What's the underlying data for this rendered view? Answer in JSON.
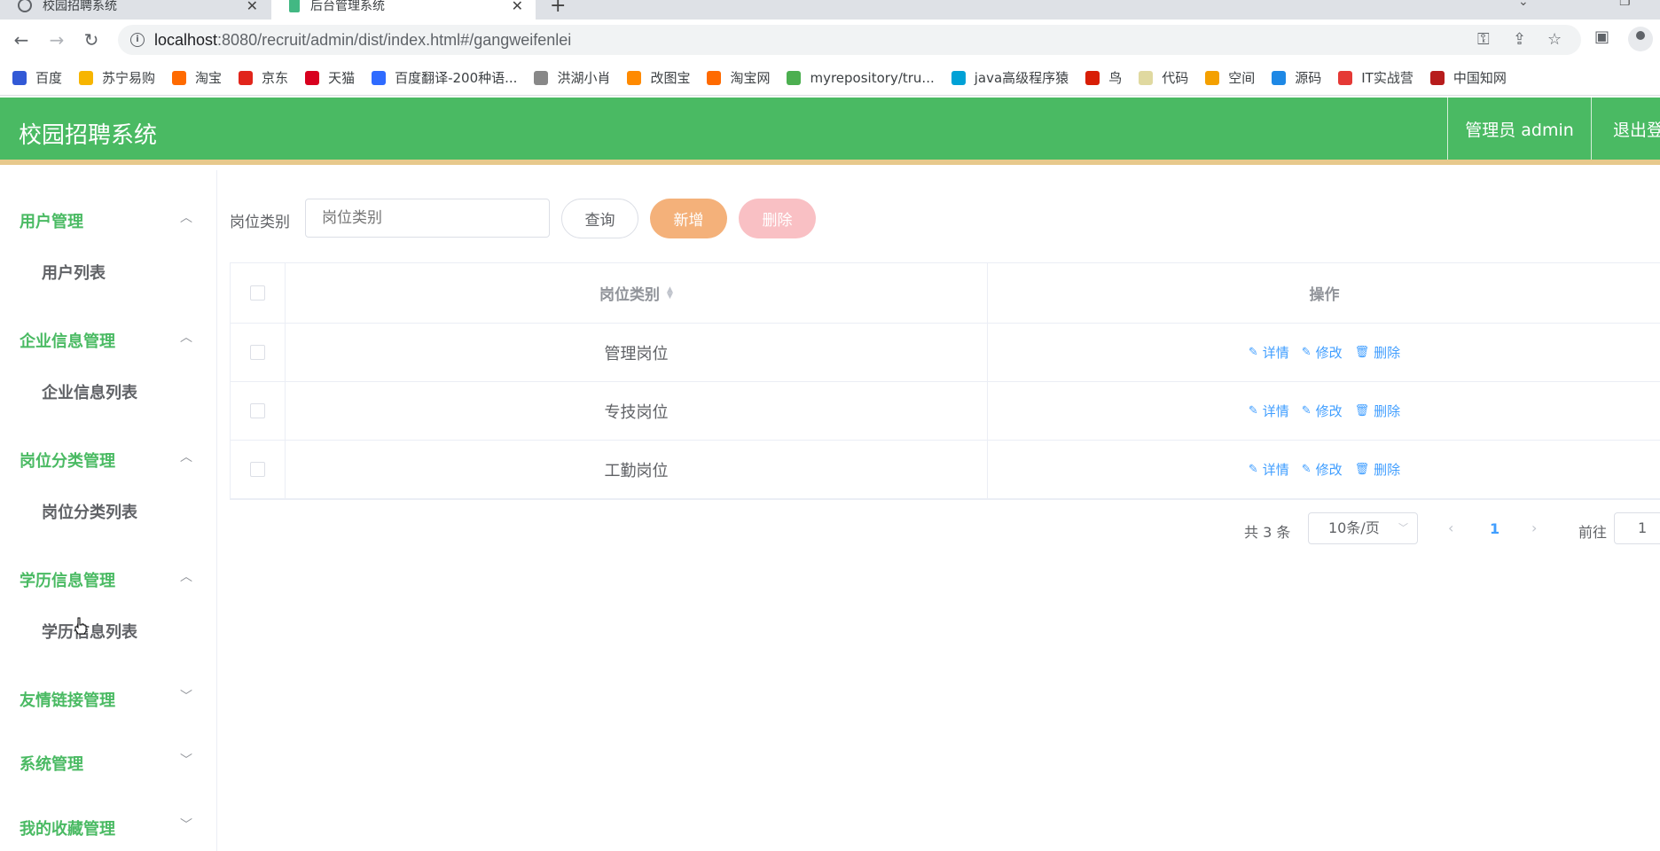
{
  "browser": {
    "tabs": [
      {
        "title": "校园招聘系统"
      },
      {
        "title": "后台管理系统"
      }
    ],
    "url_host": "localhost",
    "url_path": ":8080/recruit/admin/dist/index.html#/gangweifenlei",
    "bookmarks": [
      {
        "label": "百度",
        "color": "#3259d6"
      },
      {
        "label": "苏宁易购",
        "color": "#f7b500"
      },
      {
        "label": "淘宝",
        "color": "#ff6a00"
      },
      {
        "label": "京东",
        "color": "#e1251b"
      },
      {
        "label": "天猫",
        "color": "#d8001e"
      },
      {
        "label": "百度翻译-200种语...",
        "color": "#2f6bff"
      },
      {
        "label": "洪湖小肖",
        "color": "#888888"
      },
      {
        "label": "改图宝",
        "color": "#ff8a00"
      },
      {
        "label": "淘宝网",
        "color": "#ff6a00"
      },
      {
        "label": "myrepository/tru...",
        "color": "#4caf50"
      },
      {
        "label": "java高级程序猿",
        "color": "#00a1d6"
      },
      {
        "label": "鸟",
        "color": "#d81e06"
      },
      {
        "label": "代码",
        "color": "#e0d9a0"
      },
      {
        "label": "空间",
        "color": "#f4a000"
      },
      {
        "label": "源码",
        "color": "#1e88e5"
      },
      {
        "label": "IT实战营",
        "color": "#e53935"
      },
      {
        "label": "中国知网",
        "color": "#b71c1c"
      }
    ]
  },
  "header": {
    "title": "校园招聘系统",
    "admin": "管理员 admin",
    "logout": "退出登录"
  },
  "sidebar": {
    "groups": [
      {
        "title": "用户管理",
        "expanded": true,
        "child": "用户列表"
      },
      {
        "title": "企业信息管理",
        "expanded": true,
        "child": "企业信息列表"
      },
      {
        "title": "岗位分类管理",
        "expanded": true,
        "child": "岗位分类列表"
      },
      {
        "title": "学历信息管理",
        "expanded": true,
        "child": "学历信息列表"
      },
      {
        "title": "友情链接管理",
        "expanded": false
      },
      {
        "title": "系统管理",
        "expanded": false
      },
      {
        "title": "我的收藏管理",
        "expanded": false
      }
    ]
  },
  "filter": {
    "label": "岗位类别",
    "placeholder": "岗位类别",
    "query": "查询",
    "add": "新增",
    "delete": "删除"
  },
  "table": {
    "headers": {
      "type": "岗位类别",
      "ops": "操作"
    },
    "rows": [
      {
        "type": "管理岗位"
      },
      {
        "type": "专技岗位"
      },
      {
        "type": "工勤岗位"
      }
    ],
    "actions": {
      "detail": "详情",
      "edit": "修改",
      "remove": "删除"
    }
  },
  "pagination": {
    "total": "共 3 条",
    "page_size": "10条/页",
    "current": "1",
    "goto": "前往",
    "jump": "1"
  },
  "colors": {
    "brand": "#4aba63",
    "header_border": "#e7c98c",
    "link": "#409eff",
    "add_btn": "#f4b17a",
    "del_btn": "#f9c0c4"
  }
}
